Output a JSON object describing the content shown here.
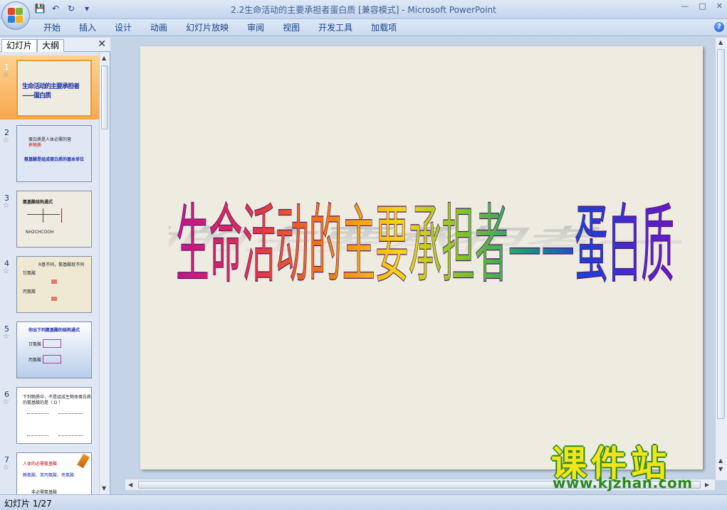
{
  "window": {
    "title": "2.2生命活动的主要承担者蛋白质 [兼容模式] - Microsoft PowerPoint"
  },
  "ribbon": {
    "tabs": [
      "开始",
      "插入",
      "设计",
      "动画",
      "幻灯片放映",
      "审阅",
      "视图",
      "开发工具",
      "加载项"
    ]
  },
  "left_pane": {
    "tabs": [
      "幻灯片",
      "大纲"
    ],
    "thumbnails": [
      {
        "num": "1",
        "title": "生命活动的主要承担者——蛋白质"
      },
      {
        "num": "2",
        "line1": "蛋白质是人体必需的营",
        "line2": "养物质",
        "line3": "氨基酸是组成蛋白质的基本单位"
      },
      {
        "num": "3",
        "line1": "氨基酸结构通式",
        "line2": "NH2CHCOOH"
      },
      {
        "num": "4",
        "line1": "R基不同，氨基酸就不同",
        "line2": "甘氨酸",
        "line3": "丙氨酸"
      },
      {
        "num": "5",
        "line1": "你出下列氨基酸的结构通式",
        "line2": "甘氨酸",
        "line3": "丙氨酸"
      },
      {
        "num": "6",
        "line1": "下列物质中，不是组成生物体蛋白质",
        "line2": "的氨基酸的是（ D ）"
      },
      {
        "num": "7",
        "line1": "人体的必需氨基酸",
        "line2": "赖氨酸、苯丙氨酸、亮氨酸",
        "line3": "非必需氨基酸"
      }
    ]
  },
  "slide": {
    "title": "生命活动的主要承担者——蛋白质"
  },
  "status": {
    "slide_counter": "幻灯片 1/27"
  },
  "watermark": {
    "name": "课件站",
    "url": "www.kjzhan.com"
  }
}
